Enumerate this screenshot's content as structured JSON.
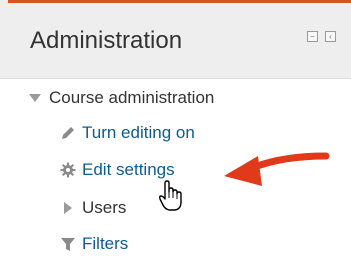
{
  "block": {
    "title": "Administration",
    "controls": [
      {
        "icon": "collapse-icon",
        "glyph": "−"
      },
      {
        "icon": "dock-icon",
        "glyph": "‹"
      }
    ]
  },
  "tree": {
    "course_admin": {
      "label": "Course administration",
      "icon": "triangle-down-icon"
    },
    "items": [
      {
        "label": "Turn editing on",
        "icon": "pencil-icon"
      },
      {
        "label": "Edit settings",
        "icon": "gear-icon"
      },
      {
        "label": "Users",
        "icon": "triangle-right-icon"
      },
      {
        "label": "Filters",
        "icon": "filter-icon"
      }
    ]
  },
  "annotation": {
    "arrow_color": "#e03a1a"
  },
  "colors": {
    "accent": "#d4561c",
    "link": "#0f5c8c",
    "header_bg": "#eeeeee"
  }
}
